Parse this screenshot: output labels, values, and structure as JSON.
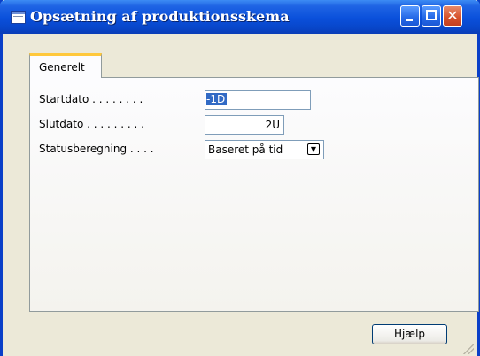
{
  "window": {
    "title": "Opsætning af produktionsskema",
    "title_icon": "form-icon",
    "controls": {
      "minimize": "minimize-icon",
      "maximize": "maximize-icon",
      "close": "close-icon"
    }
  },
  "tabs": [
    {
      "label": "Generelt",
      "active": true
    }
  ],
  "fields": {
    "startdato": {
      "label": "Startdato . . . . . . . .",
      "value": "-1D"
    },
    "slutdato": {
      "label": "Slutdato . . . . . . . . .",
      "value": "2U"
    },
    "statusberegning": {
      "label": "Statusberegning . . . .",
      "value": "Baseret på tid"
    }
  },
  "buttons": {
    "help": "Hjælp"
  },
  "colors": {
    "titlebar": "#0a50db",
    "tab_accent": "#ffc83c",
    "selection": "#316ac5"
  }
}
